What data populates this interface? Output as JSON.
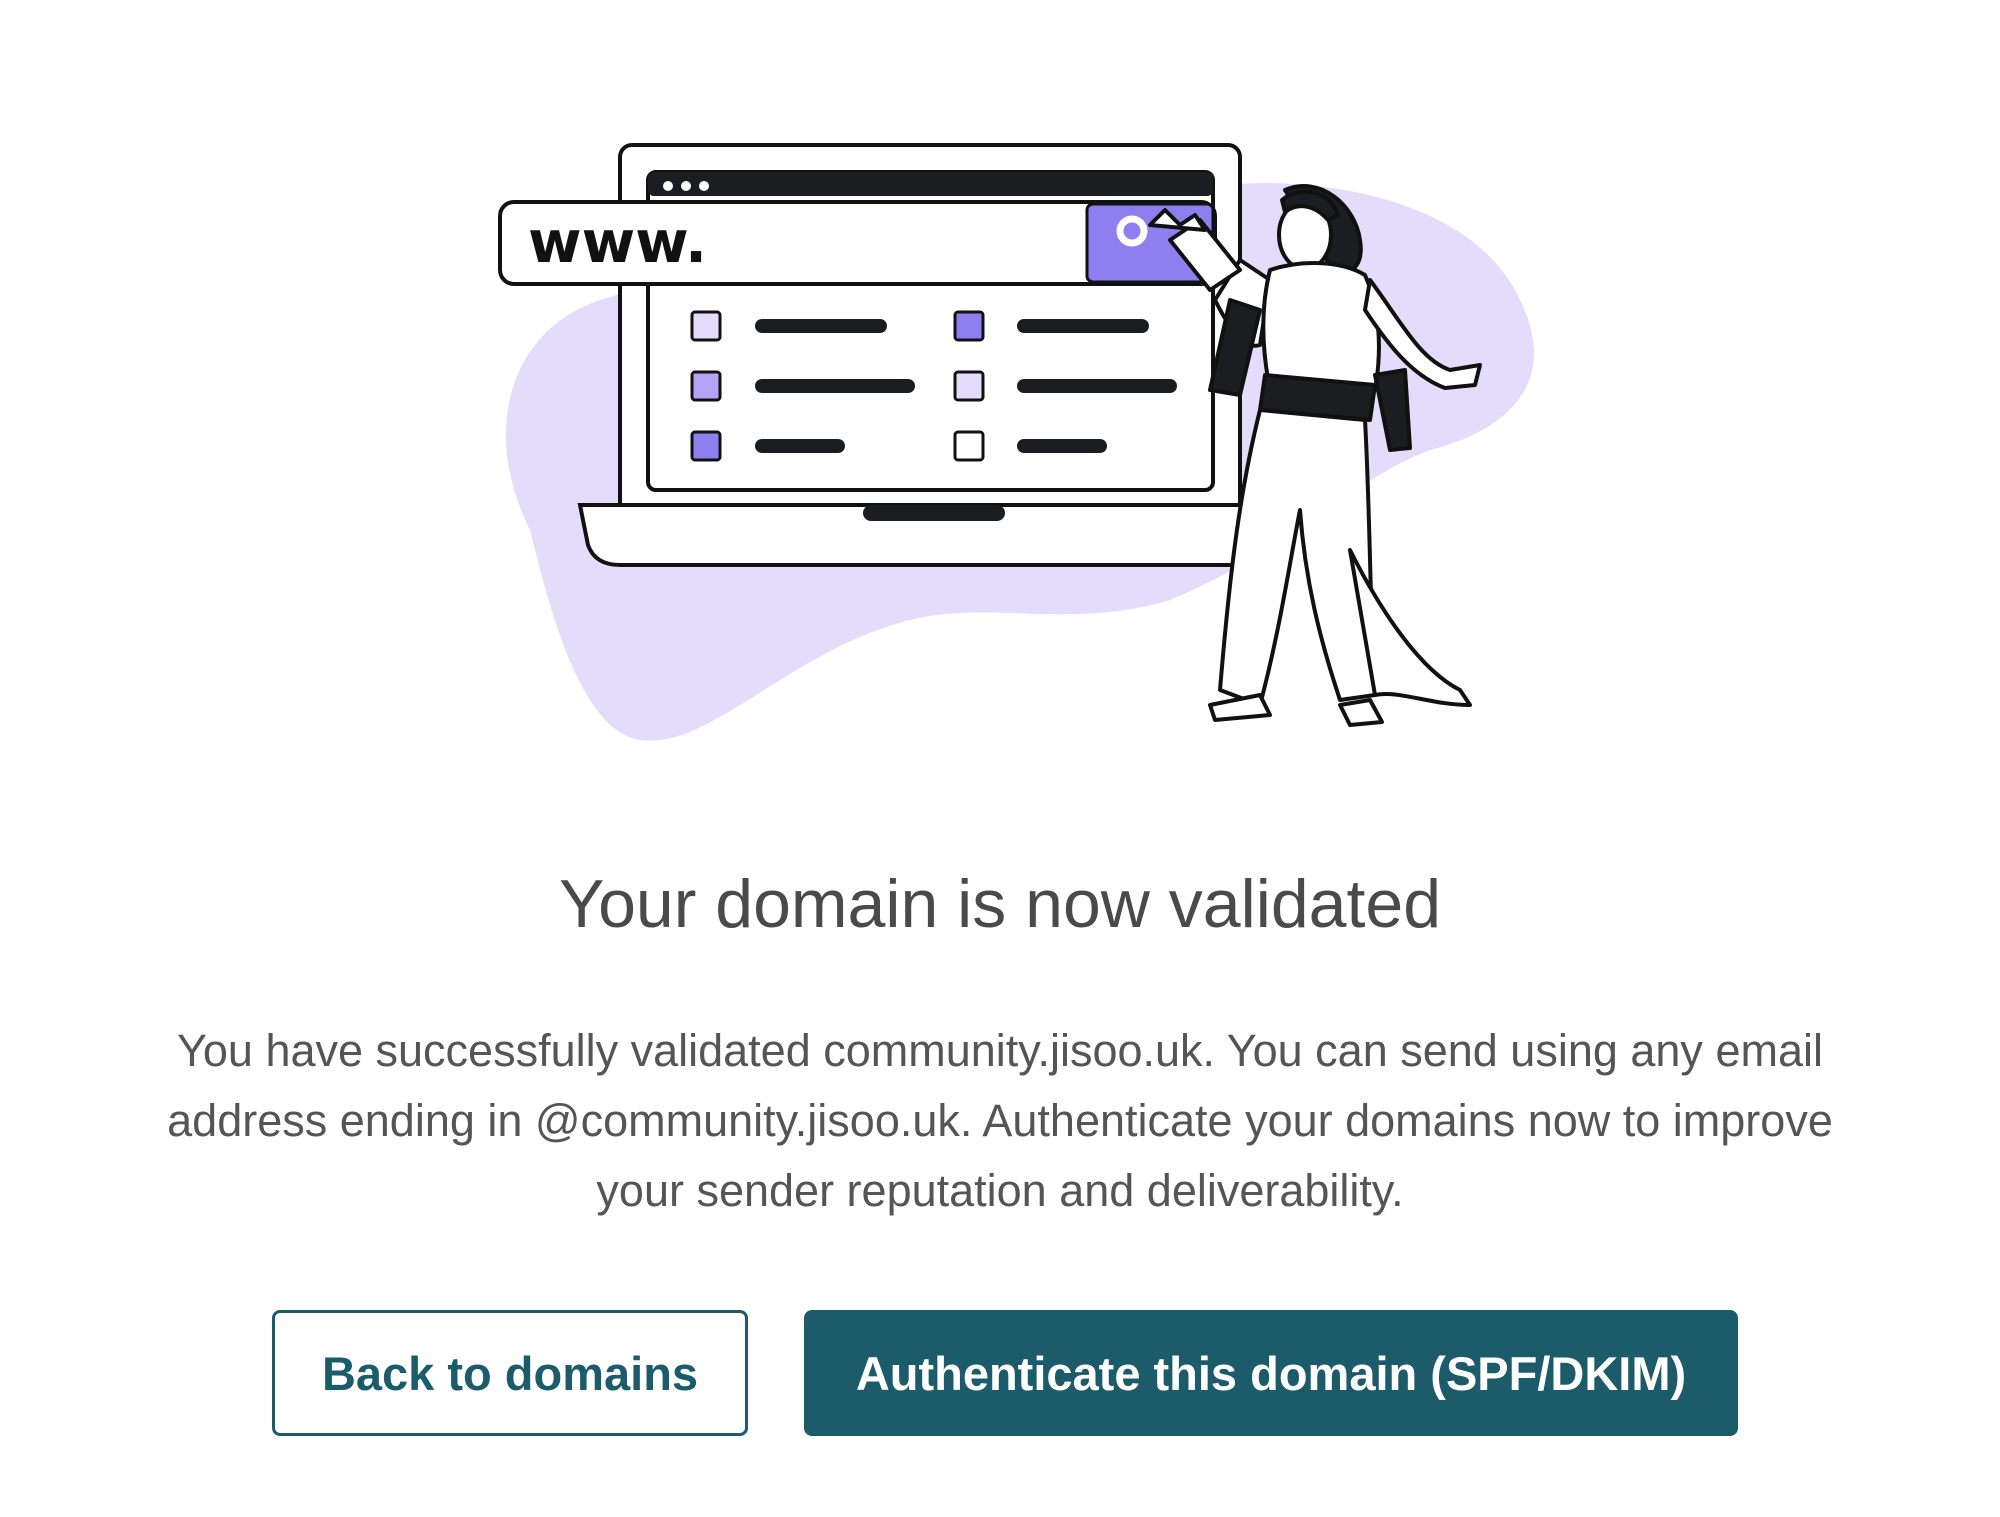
{
  "illustration": {
    "url_bar_text": "www.",
    "description": "laptop-with-search-and-woman-pointing"
  },
  "title": "Your domain is now validated",
  "description": "You have successfully validated community.jisoo.uk. You can send using any email address ending in @community.jisoo.uk. Authenticate your domains now to improve your sender reputation and deliverability.",
  "buttons": {
    "back_label": "Back to domains",
    "authenticate_label": "Authenticate this domain (SPF/DKIM)"
  },
  "colors": {
    "primary": "#1b5b6a",
    "accent_purple": "#8f7ef0",
    "light_purple": "#e4dcfb",
    "text": "#4a4a4a"
  }
}
